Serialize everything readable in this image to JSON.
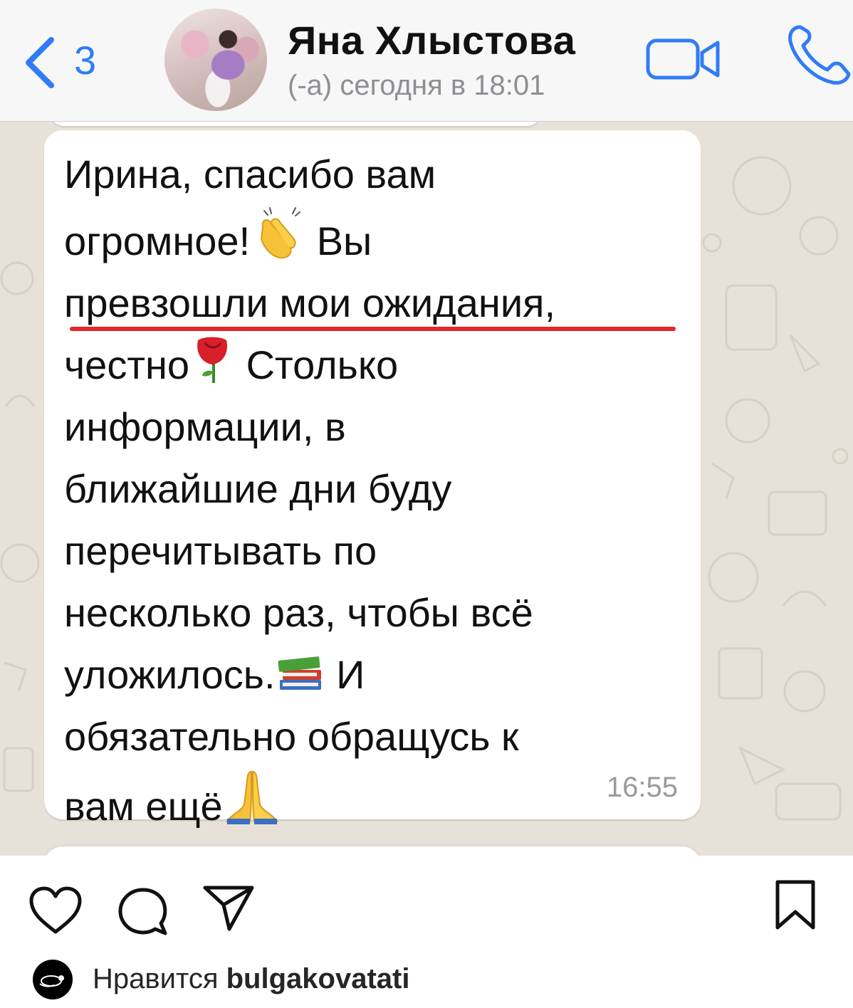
{
  "header": {
    "back_count": "3",
    "contact_name": "Яна Хлыстова",
    "last_seen": "(-а) сегодня в 18:01",
    "icons": [
      "chevron-left-icon",
      "video-call-icon",
      "phone-icon"
    ],
    "accent_color": "#2f7cf6"
  },
  "message": {
    "text_lines": {
      "l1": "Ирина, спасибо вам",
      "l2_a": "огромное!",
      "l2_b": " Вы",
      "l3": "превзошли мои ожидания,",
      "l4_a": "честно",
      "l4_b": " Столько",
      "l5": "информации, в",
      "l6": "ближайшие дни буду",
      "l7": "перечитывать по",
      "l8": "несколько раз, чтобы всё",
      "l9_a": "уложилось.",
      "l9_b": " И",
      "l10": "обязательно обращусь к",
      "l11": "вам ещё"
    },
    "emojis": [
      "clapping-hands-emoji",
      "rose-emoji",
      "books-emoji",
      "folded-hands-emoji"
    ],
    "time": "16:55",
    "highlight_color": "#e3262b"
  },
  "post_actions": {
    "icons": [
      "heart-icon",
      "comment-icon",
      "share-icon",
      "bookmark-icon"
    ],
    "likes_prefix": "Нравится ",
    "likes_user": "bulgakovatati"
  }
}
